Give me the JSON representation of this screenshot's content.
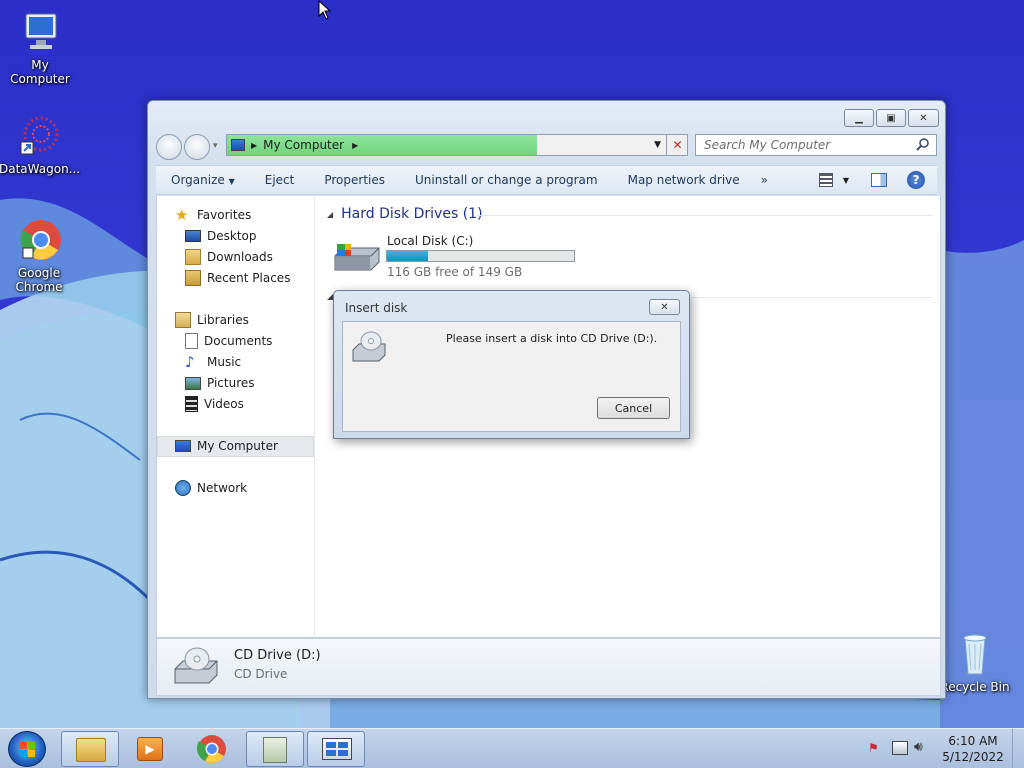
{
  "desktop": {
    "icons": [
      {
        "label": "My Computer"
      },
      {
        "label": "DataWagon..."
      },
      {
        "label": "Google\nChrome"
      },
      {
        "label": "Recycle Bin"
      }
    ]
  },
  "explorer": {
    "address_label": "My Computer",
    "search_placeholder": "Search My Computer",
    "toolbar": [
      "Organize",
      "Eject",
      "Properties",
      "Uninstall or change a program",
      "Map network drive",
      "»"
    ],
    "nav": {
      "favorites": "Favorites",
      "desktop": "Desktop",
      "downloads": "Downloads",
      "recent": "Recent Places",
      "libraries": "Libraries",
      "documents": "Documents",
      "music": "Music",
      "pictures": "Pictures",
      "videos": "Videos",
      "computer": "My Computer",
      "network": "Network"
    },
    "hdd_group": "Hard Disk Drives (1)",
    "local_disk": {
      "name": "Local Disk (C:)",
      "free": "116 GB free of 149 GB",
      "used_fraction": 0.22
    },
    "details": {
      "name": "CD Drive (D:)",
      "type": "CD Drive"
    }
  },
  "dialog": {
    "title": "Insert disk",
    "message": "Please insert a disk into CD Drive (D:).",
    "cancel": "Cancel"
  },
  "clock": {
    "time": "6:10 AM",
    "date": "5/12/2022"
  },
  "colors": {
    "accent": "#1e3287",
    "progress_green": "#6fd57c",
    "drive_bar": "#1b8fbd"
  }
}
